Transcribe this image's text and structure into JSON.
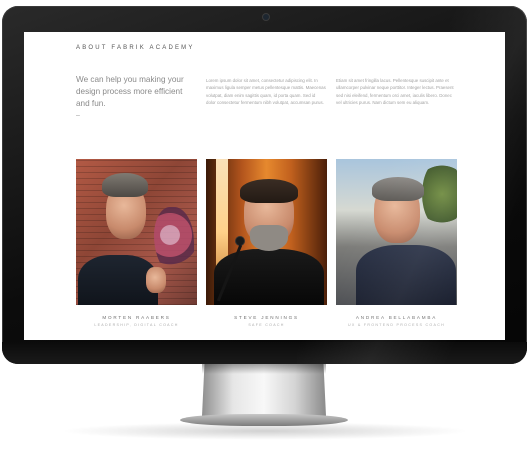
{
  "site": {
    "title": "ABOUT FABRIK ACADEMY"
  },
  "intro": {
    "headline": "We can help you making your design process more efficient and fun.",
    "dash": "–",
    "paragraph_1": "Lorem ipsum dolor sit amet, consectetur adipiscing elit. In maximus ligula semper metus pellentesque mattis. Maecenas volutpat, diam enim sagittis quam, id porta quam. Sed id dolor consectetur fermentum nibh volutpat, accumsan purus.",
    "paragraph_2": "Etiam sit amet fringilla lacus. Pellentesque suscipit ante et ullamcorper pulvinar neque porttitor. Integer lectus. Praesent sed nisi eleifend, fermentum orci amet, iaculis libero. Donec vel ultricies purus. Nam dictum sem eu aliquam."
  },
  "team": [
    {
      "name": "MORTEN RAABERS",
      "role": "LEADERSHIP, DIGITAL COACH"
    },
    {
      "name": "STEVE JENNINGS",
      "role": "SAFE COACH"
    },
    {
      "name": "ANDREA BELLABAMBA",
      "role": "UX & FRONTEND PROCESS COACH"
    }
  ],
  "icons": {
    "camera": "webcam-dot-icon"
  },
  "colors": {
    "bezel": "#0c0c0c",
    "screen_bg": "#ffffff",
    "heading_text": "#555555",
    "body_text": "#a2a2a2"
  }
}
